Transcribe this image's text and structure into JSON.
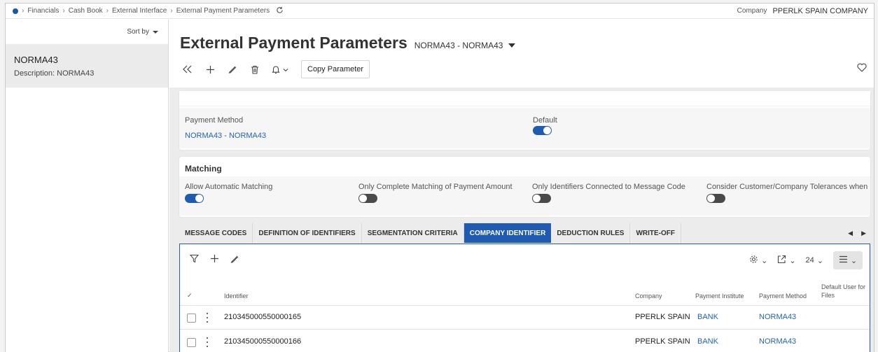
{
  "breadcrumb": [
    "Financials",
    "Cash Book",
    "External Interface",
    "External Payment Parameters"
  ],
  "company": {
    "label": "Company",
    "value": "PPERLK SPAIN COMPANY"
  },
  "sidebar": {
    "sort_label": "Sort by",
    "items": [
      {
        "title": "NORMA43",
        "description": "Description:  NORMA43"
      }
    ]
  },
  "page": {
    "title": "External Payment Parameters",
    "record": "NORMA43 - NORMA43"
  },
  "toolbar": {
    "copy_label": "Copy Parameter"
  },
  "general": {
    "payment_method_label": "Payment Method",
    "payment_method_value": "NORMA43 - NORMA43",
    "default_label": "Default",
    "default_on": true
  },
  "matching": {
    "header": "Matching",
    "fields": [
      {
        "label": "Allow Automatic Matching",
        "on": true
      },
      {
        "label": "Only Complete Matching of Payment Amount",
        "on": false
      },
      {
        "label": "Only Identifiers Connected to Message Code",
        "on": false
      },
      {
        "label": "Consider Customer/Company Tolerances when ...",
        "on": false
      }
    ]
  },
  "tabs": [
    "MESSAGE CODES",
    "DEFINITION OF IDENTIFIERS",
    "SEGMENTATION CRITERIA",
    "COMPANY IDENTIFIER",
    "DEDUCTION RULES",
    "WRITE-OFF"
  ],
  "active_tab": "COMPANY IDENTIFIER",
  "table": {
    "page_size": "24",
    "columns": {
      "identifier": "Identifier",
      "company": "Company",
      "payment_institute": "Payment Institute",
      "payment_method": "Payment Method",
      "default_user_1": "Default User for",
      "default_user_2": "Files"
    },
    "rows": [
      {
        "identifier": "210345000550000165",
        "company": "PPERLK SPAIN",
        "payment_institute": "BANK",
        "payment_method": "NORMA43"
      },
      {
        "identifier": "210345000550000166",
        "company": "PPERLK SPAIN",
        "payment_institute": "BANK",
        "payment_method": "NORMA43"
      }
    ]
  },
  "colors": {
    "accent": "#1f5bb3",
    "link": "#2563b5"
  }
}
